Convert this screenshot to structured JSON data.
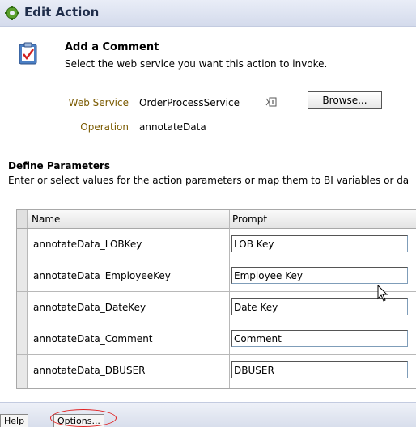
{
  "window": {
    "title": "Edit Action"
  },
  "action": {
    "heading": "Add a Comment",
    "description": "Select the web service you want this action to invoke."
  },
  "service": {
    "web_service_label": "Web Service",
    "web_service_value": "OrderProcessService",
    "operation_label": "Operation",
    "operation_value": "annotateData",
    "browse_label": "Browse..."
  },
  "parameters": {
    "title": "Define Parameters",
    "description": "Enter or select values for the action parameters or map them to BI variables or da",
    "columns": {
      "name": "Name",
      "prompt": "Prompt"
    },
    "rows": [
      {
        "name": "annotateData_LOBKey",
        "prompt": "LOB Key"
      },
      {
        "name": "annotateData_EmployeeKey",
        "prompt": "Employee Key"
      },
      {
        "name": "annotateData_DateKey",
        "prompt": "Date Key"
      },
      {
        "name": "annotateData_Comment",
        "prompt": "Comment"
      },
      {
        "name": "annotateData_DBUSER",
        "prompt": "DBUSER"
      }
    ]
  },
  "footer": {
    "tabs": [
      "Help",
      "Options..."
    ]
  },
  "icons": {
    "title_icon": "gear-icon",
    "action_icon": "clipboard-check-icon",
    "service_info": "info-icon"
  },
  "colors": {
    "label": "#7a5a00",
    "highlight": "#e02020"
  }
}
